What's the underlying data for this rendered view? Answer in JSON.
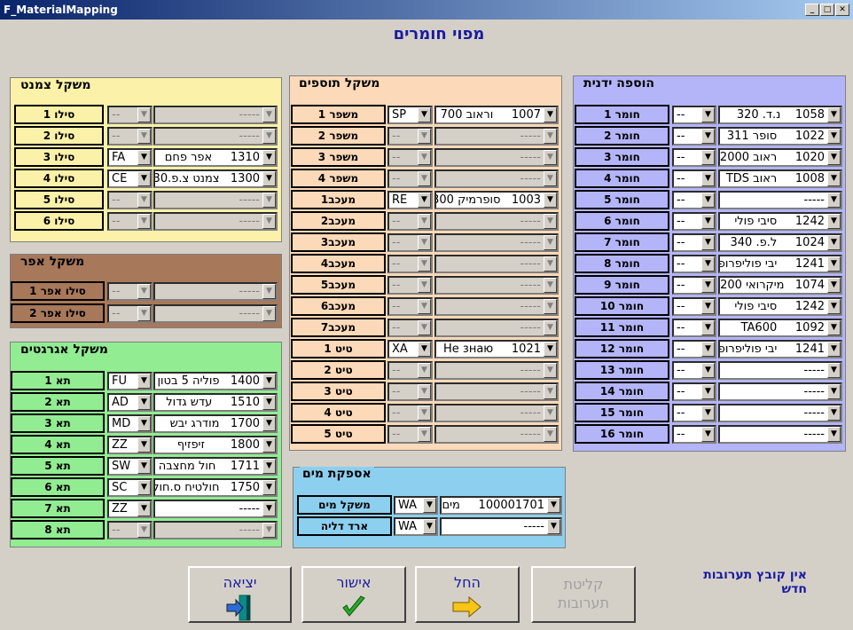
{
  "window": {
    "title": "F_MaterialMapping"
  },
  "heading": "מפוי חומרים",
  "cement": {
    "title": "משקל צמנט",
    "rows": [
      {
        "label": "סילו 1",
        "code": "--",
        "material": "-----",
        "enabled": false
      },
      {
        "label": "סילו 2",
        "code": "--",
        "material": "-----",
        "enabled": false
      },
      {
        "label": "סילו 3",
        "code": "FA",
        "material": "1310     אפר פחם",
        "enabled": true
      },
      {
        "label": "סילו 4",
        "code": "CE",
        "material": "1300   צמנט צ.פ.30",
        "enabled": true
      },
      {
        "label": "סילו 5",
        "code": "--",
        "material": "-----",
        "enabled": false
      },
      {
        "label": "סילו 6",
        "code": "--",
        "material": "-----",
        "enabled": false
      }
    ]
  },
  "ash": {
    "title": "משקל אפר",
    "rows": [
      {
        "label": "סילו אפר 1",
        "code": "--",
        "material": "-----",
        "enabled": false
      },
      {
        "label": "סילו אפר 2",
        "code": "--",
        "material": "-----",
        "enabled": false
      }
    ]
  },
  "aggregates": {
    "title": "משקל אגרגטים",
    "rows": [
      {
        "label": "תא 1",
        "code": "FU",
        "material": "1400   פוליה 5 בטון",
        "enabled": true
      },
      {
        "label": "תא 2",
        "code": "AD",
        "material": "1510     עדש גדול",
        "enabled": true
      },
      {
        "label": "תא 3",
        "code": "MD",
        "material": "1700   מודרג יבש",
        "enabled": true
      },
      {
        "label": "תא 4",
        "code": "ZZ",
        "material": "1800       זיפזיף",
        "enabled": true
      },
      {
        "label": "תא 5",
        "code": "SW",
        "material": "1711    חול מחצבה",
        "enabled": true
      },
      {
        "label": "תא 6",
        "code": "SC",
        "material": "1750   חולטיח ס.חול",
        "enabled": true
      },
      {
        "label": "תא 7",
        "code": "ZZ",
        "material": "-----",
        "enabled": true
      },
      {
        "label": "תא 8",
        "code": "--",
        "material": "-----",
        "enabled": false
      }
    ]
  },
  "additives": {
    "title": "משקל תוספים",
    "rows": [
      {
        "label": "משפר 1",
        "code": "SP",
        "material": "1007     וראוב 700",
        "enabled": true
      },
      {
        "label": "משפר 2",
        "code": "--",
        "material": "-----",
        "enabled": false
      },
      {
        "label": "משפר 3",
        "code": "--",
        "material": "-----",
        "enabled": false
      },
      {
        "label": "משפר 4",
        "code": "--",
        "material": "-----",
        "enabled": false
      },
      {
        "label": "מעכב1",
        "code": "RE",
        "material": "1003   סופרמיק 300",
        "enabled": true
      },
      {
        "label": "מעכב2",
        "code": "--",
        "material": "-----",
        "enabled": false
      },
      {
        "label": "מעכב3",
        "code": "--",
        "material": "-----",
        "enabled": false
      },
      {
        "label": "מעכב4",
        "code": "--",
        "material": "-----",
        "enabled": false
      },
      {
        "label": "מעכב5",
        "code": "--",
        "material": "-----",
        "enabled": false
      },
      {
        "label": "מעכב6",
        "code": "--",
        "material": "-----",
        "enabled": false
      },
      {
        "label": "מעכב7",
        "code": "--",
        "material": "-----",
        "enabled": false
      },
      {
        "label": "טיט 1",
        "code": "XA",
        "material": "1021     He знаю",
        "enabled": true
      },
      {
        "label": "טיט 2",
        "code": "--",
        "material": "-----",
        "enabled": false
      },
      {
        "label": "טיט 3",
        "code": "--",
        "material": "-----",
        "enabled": false
      },
      {
        "label": "טיט 4",
        "code": "--",
        "material": "-----",
        "enabled": false
      },
      {
        "label": "טיט 5",
        "code": "--",
        "material": "-----",
        "enabled": false
      }
    ]
  },
  "water": {
    "title": "אספקת מים",
    "rows": [
      {
        "label": "משקל מים",
        "code": "WA",
        "material": "100001701     מים",
        "enabled": true
      },
      {
        "label": "ארד דליה",
        "code": "WA",
        "material": "-----",
        "enabled": true
      }
    ]
  },
  "manual": {
    "title": "הוספה ידנית",
    "rows": [
      {
        "label": "חומר 1",
        "code": "--",
        "material": "1058    נ.ד. 320",
        "enabled": true
      },
      {
        "label": "חומר 2",
        "code": "--",
        "material": "1022     סופר 311",
        "enabled": true
      },
      {
        "label": "חומר 3",
        "code": "--",
        "material": "1020     ראוב 2000",
        "enabled": true
      },
      {
        "label": "חומר 4",
        "code": "--",
        "material": "1008     ראוב TDS",
        "enabled": true
      },
      {
        "label": "חומר 5",
        "code": "--",
        "material": "-----",
        "enabled": true
      },
      {
        "label": "חומר 6",
        "code": "--",
        "material": "1242     סיבי פולי",
        "enabled": true
      },
      {
        "label": "חומר 7",
        "code": "--",
        "material": "1024     ל.פ. 340",
        "enabled": true
      },
      {
        "label": "חומר 8",
        "code": "--",
        "material": "1241     יבי פוליפרופי",
        "enabled": true
      },
      {
        "label": "חומר 9",
        "code": "--",
        "material": "1074   מיקרואי 200",
        "enabled": true
      },
      {
        "label": "חומר 10",
        "code": "--",
        "material": "1242     סיבי פולי",
        "enabled": true
      },
      {
        "label": "חומר 11",
        "code": "--",
        "material": "TA600     1092",
        "enabled": true
      },
      {
        "label": "חומר 12",
        "code": "--",
        "material": "1241     יבי פוליפרופי",
        "enabled": true
      },
      {
        "label": "חומר 13",
        "code": "--",
        "material": "-----",
        "enabled": true
      },
      {
        "label": "חומר 14",
        "code": "--",
        "material": "-----",
        "enabled": true
      },
      {
        "label": "חומר 15",
        "code": "--",
        "material": "-----",
        "enabled": true
      },
      {
        "label": "חומר 16",
        "code": "--",
        "material": "-----",
        "enabled": true
      }
    ]
  },
  "buttons": {
    "exit": "יציאה",
    "confirm": "אישור",
    "start": "החל",
    "receive_line1": "קליטת",
    "receive_line2": "תערובות"
  },
  "status": "אין קובץ תערובות חדש",
  "colors": {
    "cement": "#fbf1a8",
    "ash": "#a8785a",
    "aggregates": "#92ec92",
    "additives": "#fcd9b8",
    "water": "#8ccfee",
    "manual": "#b4b4f8",
    "heading": "#1a1aa0"
  }
}
